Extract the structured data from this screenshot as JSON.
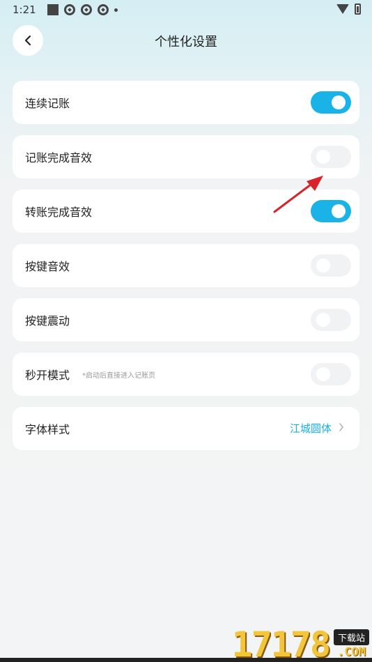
{
  "status_bar": {
    "time": "1:21"
  },
  "header": {
    "title": "个性化设置"
  },
  "settings": [
    {
      "label": "连续记账",
      "hint": "",
      "type": "toggle",
      "on": true
    },
    {
      "label": "记账完成音效",
      "hint": "",
      "type": "toggle",
      "on": false
    },
    {
      "label": "转账完成音效",
      "hint": "",
      "type": "toggle",
      "on": true
    },
    {
      "label": "按键音效",
      "hint": "",
      "type": "toggle",
      "on": false
    },
    {
      "label": "按键震动",
      "hint": "",
      "type": "toggle",
      "on": false
    },
    {
      "label": "秒开模式",
      "hint": "*启动后直接进入记账页",
      "type": "toggle",
      "on": false
    },
    {
      "label": "字体样式",
      "value": "江城圆体",
      "type": "link"
    }
  ],
  "colors": {
    "accent": "#19b3e8",
    "annotation_arrow": "#d9232b"
  },
  "watermark": {
    "number": "17178",
    "tag": "下载站",
    "domain": ".COM"
  }
}
